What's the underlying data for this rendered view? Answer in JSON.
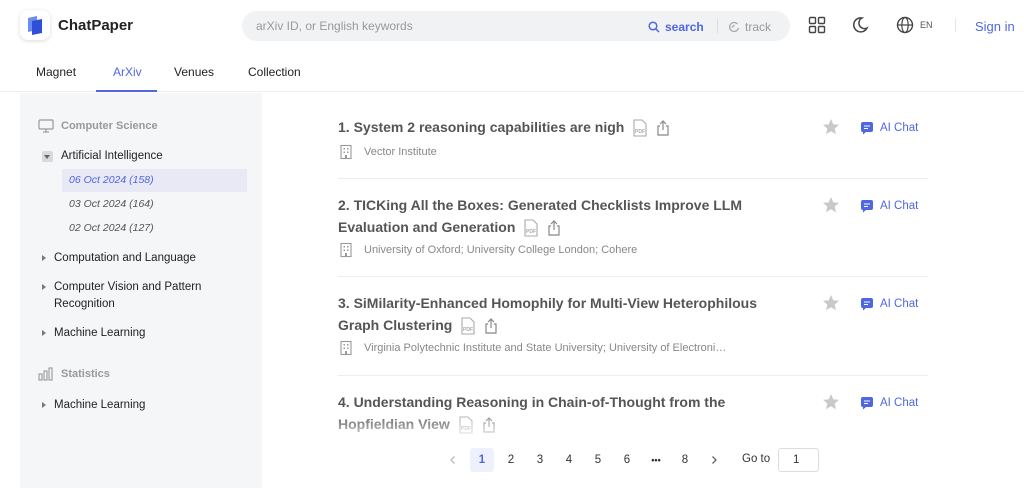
{
  "header": {
    "brand": "ChatPaper",
    "search_placeholder": "arXiv ID, or English keywords",
    "search_label": "search",
    "track_label": "track",
    "lang": "EN",
    "signin": "Sign in",
    "accent": "#4f67e0"
  },
  "tabs": [
    {
      "label": "Magnet"
    },
    {
      "label": "ArXiv",
      "active": true
    },
    {
      "label": "Venues"
    },
    {
      "label": "Collection"
    }
  ],
  "sidebar": {
    "computer_science": {
      "label": "Computer Science",
      "ai": {
        "label": "Artificial Intelligence",
        "dates": [
          {
            "label": "06 Oct 2024 (158)",
            "active": true
          },
          {
            "label": "03 Oct 2024 (164)"
          },
          {
            "label": "02 Oct 2024 (127)"
          }
        ]
      },
      "items": [
        {
          "label": "Computation and Language"
        },
        {
          "label": "Computer Vision and Pattern Recognition"
        },
        {
          "label": "Machine Learning"
        }
      ]
    },
    "statistics": {
      "label": "Statistics",
      "items": [
        {
          "label": "Machine Learning"
        }
      ]
    }
  },
  "papers": [
    {
      "title": "1. System 2 reasoning capabilities are nigh",
      "affiliation": "Vector Institute",
      "ai_chat": "AI Chat"
    },
    {
      "title": "2. TICKing All the Boxes: Generated Checklists Improve LLM Evaluation and Generation",
      "affiliation": "University of Oxford; University College London; Cohere",
      "ai_chat": "AI Chat"
    },
    {
      "title": "3. SiMilarity-Enhanced Homophily for Multi-View Heterophilous Graph Clustering",
      "affiliation": "Virginia Polytechnic Institute and State University; University of Electroni…",
      "ai_chat": "AI Chat"
    },
    {
      "title": "4. Understanding Reasoning in Chain-of-Thought from the Hopfieldian View",
      "affiliation": "",
      "ai_chat": "AI Chat"
    }
  ],
  "pagination": {
    "pages": [
      "1",
      "2",
      "3",
      "4",
      "5",
      "6",
      "•••",
      "8"
    ],
    "current": "1",
    "goto_label": "Go to",
    "goto_value": "1"
  }
}
